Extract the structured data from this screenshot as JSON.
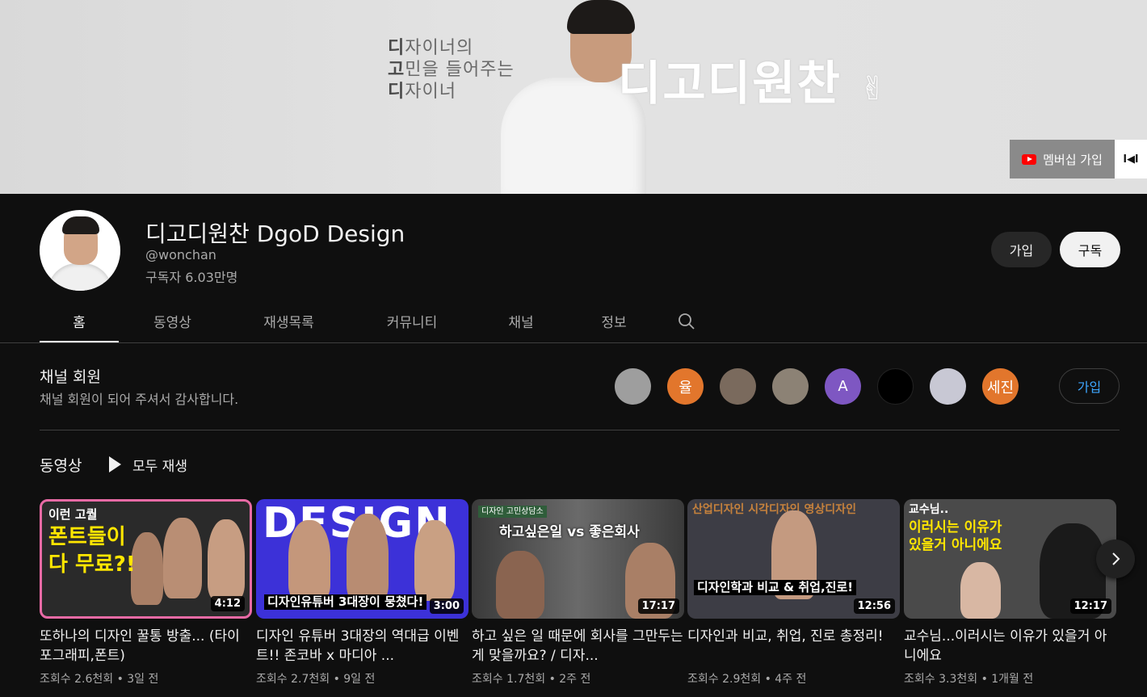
{
  "banner": {
    "tagline_lines": [
      {
        "first": "디",
        "rest": "자이너의"
      },
      {
        "first": "고",
        "rest": "민을 들어주는"
      },
      {
        "first": "디",
        "rest": "자이너"
      }
    ],
    "title": "디고디원찬",
    "title_icon": "✌",
    "membership_label": "멤버십 가입",
    "membership_icon": "youtube-icon",
    "watermark_text": "l◀l"
  },
  "channel": {
    "name": "디고디원찬 DgoD Design",
    "handle": "@wonchan",
    "subscribers": "구독자 6.03만명",
    "join_label": "가입",
    "subscribe_label": "구독"
  },
  "tabs": [
    {
      "label": "홈",
      "active": true
    },
    {
      "label": "동영상",
      "active": false
    },
    {
      "label": "재생목록",
      "active": false
    },
    {
      "label": "커뮤니티",
      "active": false
    },
    {
      "label": "채널",
      "active": false
    },
    {
      "label": "정보",
      "active": false
    }
  ],
  "members": {
    "title": "채널 회원",
    "subtitle": "채널 회원이 되어 주셔서 감사합니다.",
    "avatars": [
      {
        "text": "",
        "color": "#9e9e9e"
      },
      {
        "text": "율",
        "color": "#e2762c"
      },
      {
        "text": "",
        "color": "#7a6a5d"
      },
      {
        "text": "",
        "color": "#8c8275"
      },
      {
        "text": "A",
        "color": "#7e57c2"
      },
      {
        "text": "",
        "color": "#000000"
      },
      {
        "text": "",
        "color": "#c8c8d4"
      },
      {
        "text": "세진",
        "color": "#e2762c"
      }
    ],
    "join_label": "가입"
  },
  "videos": {
    "section_title": "동영상",
    "play_all_label": "모두 재생",
    "items": [
      {
        "title": "또하나의 디자인 꿀통 방출... (타이포그래피,폰트)",
        "meta": "조회수 2.6천회 • 3일 전",
        "duration": "4:12",
        "thumb_text": [
          "이런 고퀄",
          "폰트들이",
          "다 무료?!"
        ]
      },
      {
        "title": "디자인 유튜버 3대장의 역대급 이벤트!! 존코바 x 마디아 ...",
        "meta": "조회수 2.7천회 • 9일 전",
        "duration": "3:00",
        "thumb_text": [
          "DESIGN",
          "디자인유튜버 3대장이 뭉쳤다!"
        ]
      },
      {
        "title": "하고 싶은 일 때문에 회사를 그만두는게 맞을까요? / 디자...",
        "meta": "조회수 1.7천회 • 2주 전",
        "duration": "17:17",
        "thumb_text": [
          "디자인 고민상담소",
          "하고싶은일 vs 좋은회사"
        ]
      },
      {
        "title": "디자인과 비교, 취업, 진로 총정리!",
        "meta": "조회수 2.9천회 • 4주 전",
        "duration": "12:56",
        "thumb_text": [
          "산업디자인 시각디자인 영상디자인",
          "디자인학과 비교 & 취업,진로!"
        ]
      },
      {
        "title": "교수님...이러시는 이유가 있을거 아니에요",
        "meta": "조회수 3.3천회 • 1개월 전",
        "duration": "12:17",
        "thumb_text": [
          "교수님..",
          "이러시는 이유가",
          "있을거 아니에요"
        ]
      }
    ]
  },
  "colors": {
    "background": "#0f0f0f",
    "text_primary": "#f1f1f1",
    "text_secondary": "#aaaaaa",
    "link_blue": "#3ea6ff"
  }
}
